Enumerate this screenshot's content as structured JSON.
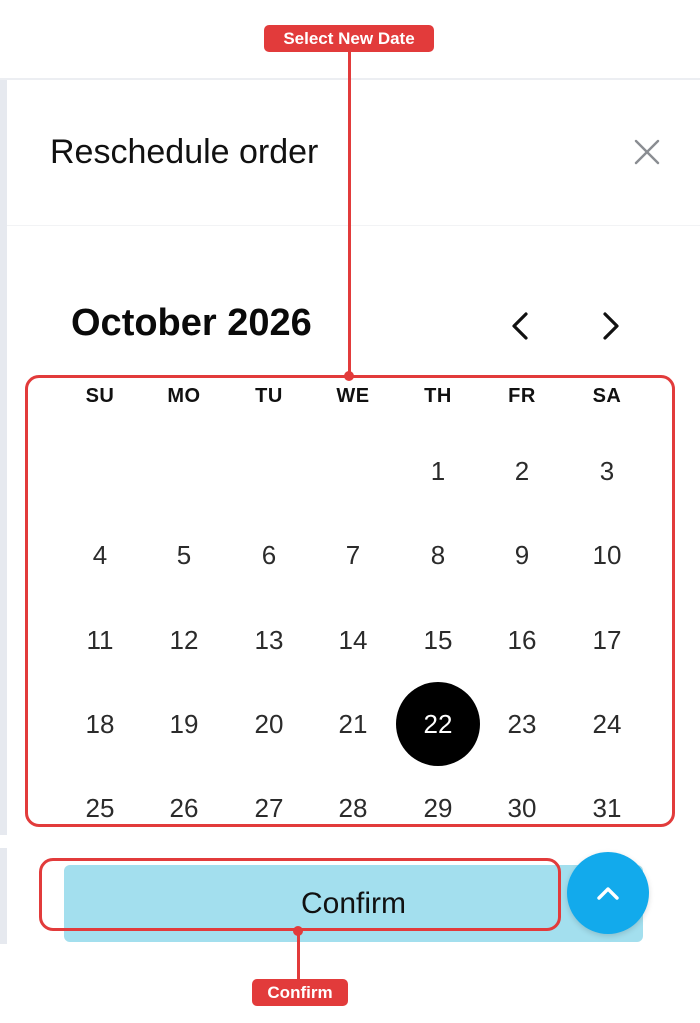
{
  "modal": {
    "title": "Reschedule order",
    "close_icon": "close-icon"
  },
  "calendar": {
    "month_label": "October 2026",
    "prev_icon": "chevron-left-icon",
    "next_icon": "chevron-right-icon",
    "weekdays": [
      "SU",
      "MO",
      "TU",
      "WE",
      "TH",
      "FR",
      "SA"
    ],
    "weeks": [
      [
        "",
        "",
        "",
        "",
        "1",
        "2",
        "3"
      ],
      [
        "4",
        "5",
        "6",
        "7",
        "8",
        "9",
        "10"
      ],
      [
        "11",
        "12",
        "13",
        "14",
        "15",
        "16",
        "17"
      ],
      [
        "18",
        "19",
        "20",
        "21",
        "22",
        "23",
        "24"
      ],
      [
        "25",
        "26",
        "27",
        "28",
        "29",
        "30",
        "31"
      ]
    ],
    "selected_day": "22"
  },
  "actions": {
    "confirm_label": "Confirm",
    "scroll_top_icon": "chevron-up-icon"
  },
  "annotations": {
    "calendar_label": "Select New Date",
    "confirm_label": "Confirm"
  },
  "colors": {
    "annotation": "#e23b3b",
    "confirm_bg": "#a3dfee",
    "fab_bg": "#12aaec",
    "selected_bg": "#000000"
  }
}
